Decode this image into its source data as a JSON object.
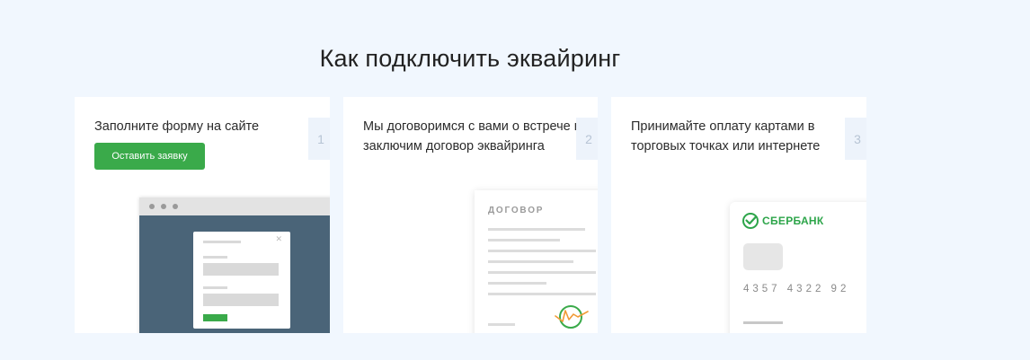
{
  "heading": "Как подключить эквайринг",
  "steps": [
    {
      "text": "Заполните форму на сайте",
      "number": "1",
      "button_label": "Оставить заявку"
    },
    {
      "text": "Мы договоримся с вами о встрече и заключим договор эквайринга",
      "number": "2",
      "doc_title": "ДОГОВОР"
    },
    {
      "text": "Принимайте оплату картами в торговых точках или интернете",
      "number": "3",
      "bank_name": "СБЕРБАНК",
      "card_number": "4357 4322 92"
    }
  ],
  "colors": {
    "accent_green": "#3aaa4a",
    "page_background": "#f1f7fe",
    "browser_body": "#4a6478"
  },
  "icons": [
    "sberbank-logo-icon",
    "signature-seal-icon"
  ]
}
